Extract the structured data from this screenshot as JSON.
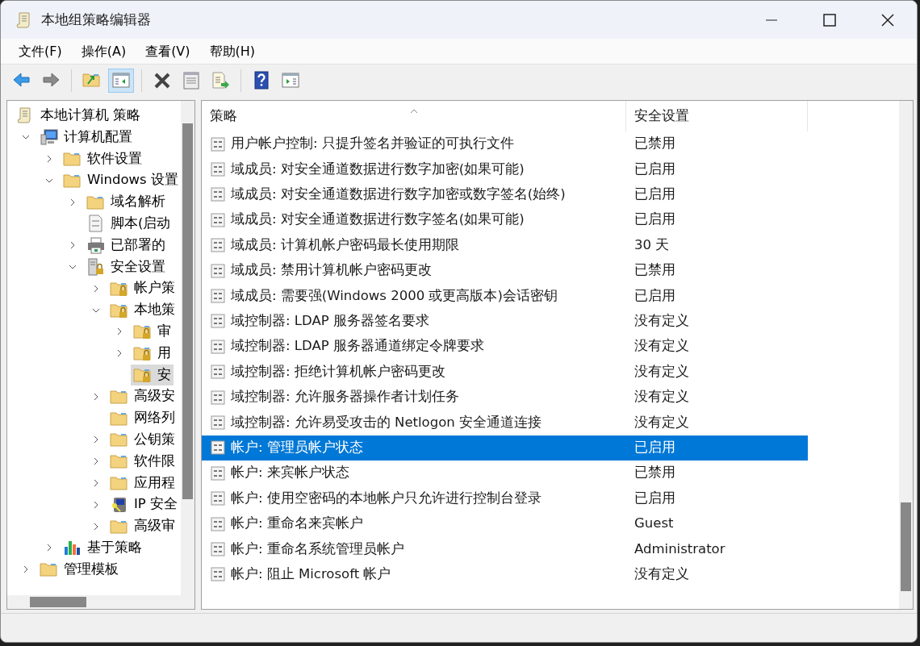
{
  "window": {
    "title": "本地组策略编辑器"
  },
  "menu": [
    "文件(F)",
    "操作(A)",
    "查看(V)",
    "帮助(H)"
  ],
  "toolbar": [
    {
      "kind": "back",
      "pressed": false
    },
    {
      "kind": "forward",
      "pressed": false
    },
    {
      "kind": "sep"
    },
    {
      "kind": "up",
      "pressed": false
    },
    {
      "kind": "tree",
      "pressed": true
    },
    {
      "kind": "sep"
    },
    {
      "kind": "delete",
      "pressed": false
    },
    {
      "kind": "properties",
      "pressed": false
    },
    {
      "kind": "export",
      "pressed": false
    },
    {
      "kind": "sep"
    },
    {
      "kind": "help",
      "pressed": false
    },
    {
      "kind": "pane",
      "pressed": false
    }
  ],
  "tree": [
    {
      "label": "本地计算机 策略",
      "kind": "scroll",
      "selected": false,
      "children": [
        {
          "label": "计算机配置",
          "kind": "computer",
          "expanded": true,
          "selected": false,
          "children": [
            {
              "label": "软件设置",
              "kind": "folder",
              "expanded": false,
              "selected": false
            },
            {
              "label": "Windows 设置",
              "kind": "folder",
              "expanded": true,
              "selected": false,
              "children": [
                {
                  "label": "域名解析",
                  "kind": "folder",
                  "expanded": false,
                  "selected": false
                },
                {
                  "label": "脚本(启动",
                  "kind": "script",
                  "selected": false
                },
                {
                  "label": "已部署的",
                  "kind": "printer",
                  "expanded": false,
                  "selected": false
                },
                {
                  "label": "安全设置",
                  "kind": "server",
                  "expanded": true,
                  "selected": false,
                  "children": [
                    {
                      "label": "帐户策",
                      "kind": "lockfolder",
                      "expanded": false,
                      "selected": false
                    },
                    {
                      "label": "本地策",
                      "kind": "lockfolder",
                      "expanded": true,
                      "selected": false,
                      "children": [
                        {
                          "label": "审",
                          "kind": "lockfolder",
                          "expanded": false,
                          "selected": false
                        },
                        {
                          "label": "用",
                          "kind": "lockfolder",
                          "expanded": false,
                          "selected": false
                        },
                        {
                          "label": "安",
                          "kind": "lockfolder",
                          "selected": true
                        }
                      ]
                    },
                    {
                      "label": "高级安",
                      "kind": "folder",
                      "expanded": false,
                      "selected": false
                    },
                    {
                      "label": "网络列",
                      "kind": "folder",
                      "selected": false
                    },
                    {
                      "label": "公钥策",
                      "kind": "folder",
                      "expanded": false,
                      "selected": false
                    },
                    {
                      "label": "软件限",
                      "kind": "folder",
                      "expanded": false,
                      "selected": false
                    },
                    {
                      "label": "应用程",
                      "kind": "folder",
                      "expanded": false,
                      "selected": false
                    },
                    {
                      "label": "IP 安全",
                      "kind": "ipkey",
                      "expanded": false,
                      "selected": false
                    },
                    {
                      "label": "高级审",
                      "kind": "folder",
                      "expanded": false,
                      "selected": false
                    }
                  ]
                }
              ]
            },
            {
              "label": "基于策略",
              "kind": "chart",
              "expanded": false,
              "selected": false
            }
          ]
        },
        {
          "label": "管理模板",
          "kind": "folder",
          "expanded": false,
          "selected": false
        }
      ]
    }
  ],
  "table": {
    "columns": [
      "策略",
      "安全设置"
    ],
    "rows": [
      {
        "policy": "用户帐户控制: 只提升签名并验证的可执行文件",
        "setting": "已禁用",
        "selected": false
      },
      {
        "policy": "域成员: 对安全通道数据进行数字加密(如果可能)",
        "setting": "已启用",
        "selected": false
      },
      {
        "policy": "域成员: 对安全通道数据进行数字加密或数字签名(始终)",
        "setting": "已启用",
        "selected": false
      },
      {
        "policy": "域成员: 对安全通道数据进行数字签名(如果可能)",
        "setting": "已启用",
        "selected": false
      },
      {
        "policy": "域成员: 计算机帐户密码最长使用期限",
        "setting": "30 天",
        "selected": false
      },
      {
        "policy": "域成员: 禁用计算机帐户密码更改",
        "setting": "已禁用",
        "selected": false
      },
      {
        "policy": "域成员: 需要强(Windows 2000 或更高版本)会话密钥",
        "setting": "已启用",
        "selected": false
      },
      {
        "policy": "域控制器: LDAP 服务器签名要求",
        "setting": "没有定义",
        "selected": false
      },
      {
        "policy": "域控制器: LDAP 服务器通道绑定令牌要求",
        "setting": "没有定义",
        "selected": false
      },
      {
        "policy": "域控制器: 拒绝计算机帐户密码更改",
        "setting": "没有定义",
        "selected": false
      },
      {
        "policy": "域控制器: 允许服务器操作者计划任务",
        "setting": "没有定义",
        "selected": false
      },
      {
        "policy": "域控制器: 允许易受攻击的 Netlogon 安全通道连接",
        "setting": "没有定义",
        "selected": false
      },
      {
        "policy": "帐户: 管理员帐户状态",
        "setting": "已启用",
        "selected": true
      },
      {
        "policy": "帐户: 来宾帐户状态",
        "setting": "已禁用",
        "selected": false
      },
      {
        "policy": "帐户: 使用空密码的本地帐户只允许进行控制台登录",
        "setting": "已启用",
        "selected": false
      },
      {
        "policy": "帐户: 重命名来宾帐户",
        "setting": "Guest",
        "selected": false
      },
      {
        "policy": "帐户: 重命名系统管理员帐户",
        "setting": "Administrator",
        "selected": false
      },
      {
        "policy": "帐户: 阻止 Microsoft 帐户",
        "setting": "没有定义",
        "selected": false
      }
    ]
  }
}
